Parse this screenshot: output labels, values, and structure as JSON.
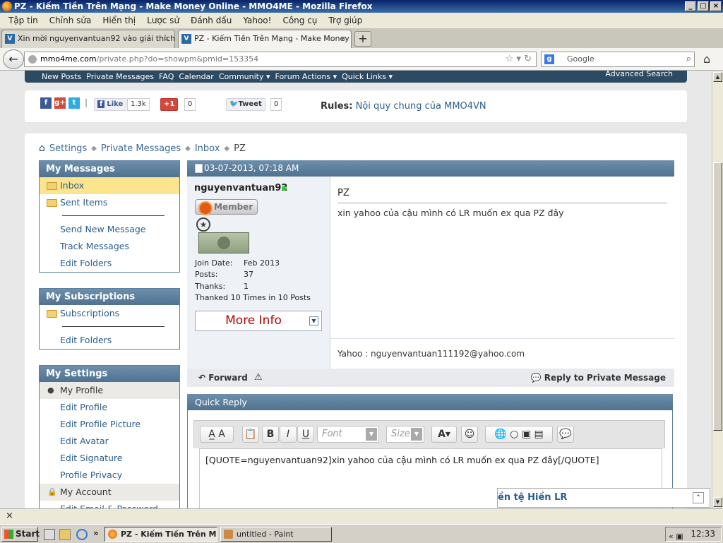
{
  "window": {
    "title": "PZ - Kiếm Tiền Trên Mạng - Make Money Online - MMO4ME - Mozilla Firefox"
  },
  "menu": [
    "Tập tin",
    "Chỉnh sửa",
    "Hiển thị",
    "Lược sử",
    "Đánh dấu",
    "Yahoo!",
    "Công cụ",
    "Trợ giúp"
  ],
  "tabs": [
    {
      "label": "Xin mời nguyenvantuan92 vào giải thích ...",
      "close": "×"
    },
    {
      "label": "PZ - Kiếm Tiền Trên Mạng - Make Money ...",
      "close": "×"
    }
  ],
  "newtab_label": "+",
  "address": {
    "host": "mmo4me.com",
    "path": "/private.php?do=showpm&pmid=153354"
  },
  "search": {
    "engine_icon": "g",
    "placeholder": "Google"
  },
  "sitenav": {
    "items": [
      "New Posts",
      "Private Messages",
      "FAQ",
      "Calendar",
      "Community ▾",
      "Forum Actions ▾",
      "Quick Links ▾"
    ],
    "advanced": "Advanced Search"
  },
  "social": {
    "fb_like": "Like",
    "fb_count": "1.3k",
    "gplus": "+1",
    "gplus_count": "0",
    "tweet": "Tweet",
    "tweet_count": "0",
    "rules_label": "Rules:",
    "rules_link": "Nội quy chung của MMO4VN"
  },
  "breadcrumb": [
    "Settings",
    "Private Messages",
    "Inbox",
    "PZ"
  ],
  "sidebar": {
    "messages": {
      "title": "My Messages",
      "folders": [
        "Inbox",
        "Sent Items"
      ],
      "links": [
        "Send New Message",
        "Track Messages",
        "Edit Folders"
      ]
    },
    "subscriptions": {
      "title": "My Subscriptions",
      "folders": [
        "Subscriptions"
      ],
      "links": [
        "Edit Folders"
      ]
    },
    "settings": {
      "title": "My Settings",
      "profile_group": "My Profile",
      "profile_links": [
        "Edit Profile",
        "Edit Profile Picture",
        "Edit Avatar",
        "Edit Signature",
        "Profile Privacy"
      ],
      "account_group": "My Account",
      "account_links": [
        "Edit Email & Password"
      ]
    }
  },
  "message": {
    "date": "03-07-2013, 07:18 AM",
    "username": "nguyenvantuan92",
    "rank": "Member",
    "join_label": "Join Date:",
    "join_value": "Feb 2013",
    "posts_label": "Posts:",
    "posts_value": "37",
    "thanks_label": "Thanks:",
    "thanks_value": "1",
    "thanked": "Thanked 10 Times in 10 Posts",
    "more_info": "More Info",
    "title": "PZ",
    "body": "xin yahoo của cậu mình có LR muốn ex qua PZ đây",
    "signature": "Yahoo : nguyenvantuan111192@yahoo.com",
    "forward": "Forward",
    "reply": "Reply to Private Message"
  },
  "quick_reply": {
    "title": "Quick Reply",
    "font_placeholder": "Font",
    "size_placeholder": "Size",
    "editor_text": "[QUOTE=nguyenvantuan92]xin yahoo của cậu mình có LR muốn ex qua PZ đây[/QUOTE]"
  },
  "chatbox": {
    "label": "ền tệ Hiền LR"
  },
  "taskbar": {
    "start": "Start",
    "tasks": [
      "PZ - Kiếm Tiền Trên M...",
      "untitled - Paint"
    ],
    "clock": "12:33"
  },
  "colors": {
    "header_blue": "#4f7290",
    "nav_dark": "#2d4a63",
    "link_blue": "#2a5d8e",
    "selected_yellow": "#fce58d"
  }
}
